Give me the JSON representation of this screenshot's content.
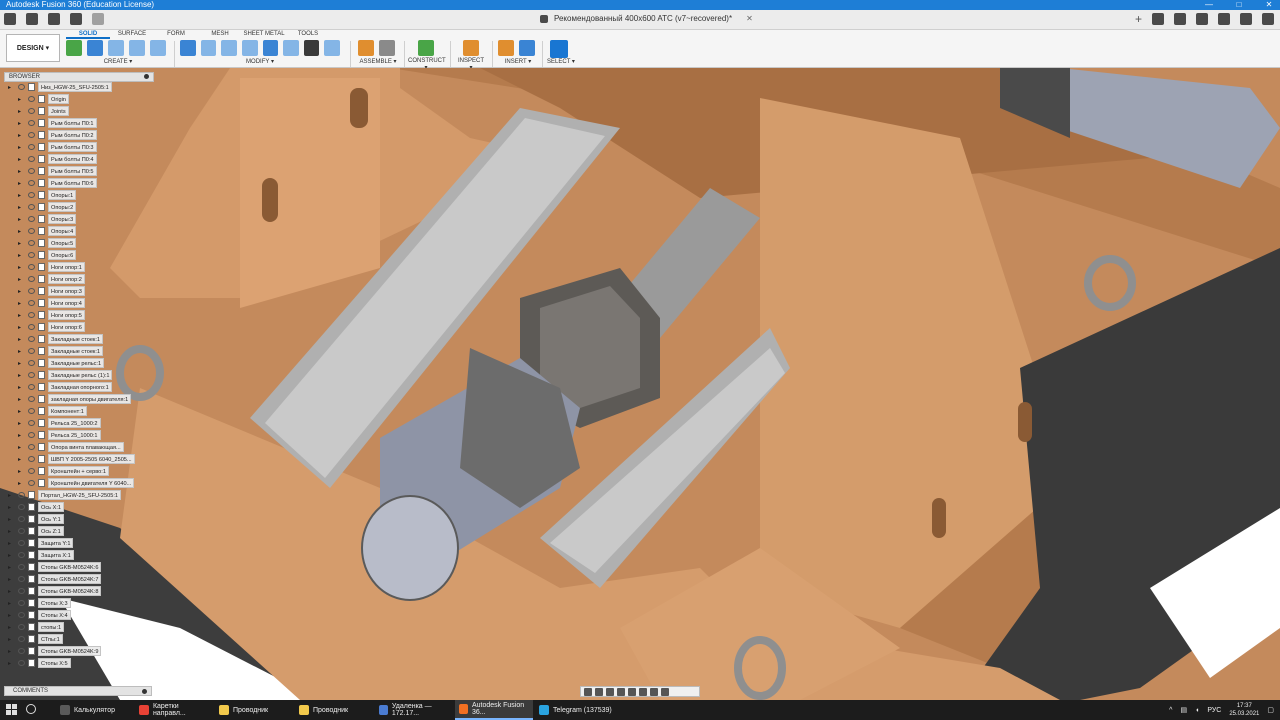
{
  "app": {
    "title": "Autodesk Fusion 360 (Education License)",
    "window_controls": [
      "—",
      "□",
      "✕"
    ]
  },
  "quick_access": {
    "document_tab": "Рекомендованный 400x600 ATC (v7~recovered)*",
    "close_symbol": "✕",
    "new_tab_symbol": "+"
  },
  "toolbar": {
    "design_label": "DESIGN ▾",
    "tabs": [
      "SOLID",
      "SURFACE",
      "FORM",
      "MESH",
      "SHEET METAL",
      "TOOLS"
    ],
    "active_tab": "SOLID",
    "groups": [
      {
        "label": "CREATE ▾"
      },
      {
        "label": "MODIFY ▾"
      },
      {
        "label": "ASSEMBLE ▾"
      },
      {
        "label": "CONSTRUCT ▾"
      },
      {
        "label": "INSPECT ▾"
      },
      {
        "label": "INSERT ▾"
      },
      {
        "label": "SELECT ▾"
      }
    ]
  },
  "browser": {
    "title": "BROWSER",
    "items": [
      {
        "label": "Низ_HGW-25_SFU-2505:1",
        "level": 0
      },
      {
        "label": "Origin",
        "level": 1
      },
      {
        "label": "Joints",
        "level": 1
      },
      {
        "label": "Рым болты П0:1",
        "level": 1
      },
      {
        "label": "Рым болты П0:2",
        "level": 1
      },
      {
        "label": "Рым болты П0:3",
        "level": 1
      },
      {
        "label": "Рым болты П0:4",
        "level": 1
      },
      {
        "label": "Рым болты П0:5",
        "level": 1
      },
      {
        "label": "Рым болты П0:6",
        "level": 1
      },
      {
        "label": "Опоры:1",
        "level": 1
      },
      {
        "label": "Опоры:2",
        "level": 1
      },
      {
        "label": "Опоры:3",
        "level": 1
      },
      {
        "label": "Опоры:4",
        "level": 1
      },
      {
        "label": "Опоры:5",
        "level": 1
      },
      {
        "label": "Опоры:6",
        "level": 1
      },
      {
        "label": "Ноги опор:1",
        "level": 1
      },
      {
        "label": "Ноги опор:2",
        "level": 1
      },
      {
        "label": "Ноги опор:3",
        "level": 1
      },
      {
        "label": "Ноги опор:4",
        "level": 1
      },
      {
        "label": "Ноги опор:5",
        "level": 1
      },
      {
        "label": "Ноги опор:6",
        "level": 1
      },
      {
        "label": "Закладные стоек:1",
        "level": 1
      },
      {
        "label": "Закладные стоек:1",
        "level": 1
      },
      {
        "label": "Закладные рельс:1",
        "level": 1
      },
      {
        "label": "Закладные рельс (1):1",
        "level": 1
      },
      {
        "label": "Закладная опорного:1",
        "level": 1
      },
      {
        "label": "закладная опоры двигателя:1",
        "level": 1
      },
      {
        "label": "Компонент:1",
        "level": 1
      },
      {
        "label": "Рельса 25_1000:2",
        "level": 1
      },
      {
        "label": "Рельса 25_1000:1",
        "level": 1
      },
      {
        "label": "Опора винта плавающая...",
        "level": 1
      },
      {
        "label": "ШВП Y 2005-2505 6040_2505...",
        "level": 1
      },
      {
        "label": "Кронштейн + серво:1",
        "level": 1
      },
      {
        "label": "Кронштейн двигателя Y 6040...",
        "level": 1
      },
      {
        "label": "Портал_HGW-25_SFU-2505:1",
        "level": 0
      },
      {
        "label": "Ось X:1",
        "level": 0
      },
      {
        "label": "Ось Y:1",
        "level": 0
      },
      {
        "label": "Ось Z:1",
        "level": 0
      },
      {
        "label": "Защита Y:1",
        "level": 0
      },
      {
        "label": "Защита X:1",
        "level": 0
      },
      {
        "label": "Стопы GKB-M0524K:6",
        "level": 0
      },
      {
        "label": "Стопы GKB-M0524K:7",
        "level": 0
      },
      {
        "label": "Стопы GKB-M0524K:8",
        "level": 0
      },
      {
        "label": "Стопы X:3",
        "level": 0
      },
      {
        "label": "Стопы X:4",
        "level": 0
      },
      {
        "label": "стопы:1",
        "level": 0
      },
      {
        "label": "СТпы:1",
        "level": 0
      },
      {
        "label": "Стопы GKB-M0524K:9",
        "level": 0
      },
      {
        "label": "Стопы X:5",
        "level": 0
      }
    ]
  },
  "comments": {
    "title": "COMMENTS"
  },
  "taskbar": {
    "tasks": [
      {
        "label": "Калькулятор",
        "color": "#5a5a5a"
      },
      {
        "label": "Каретки направл...",
        "color": "#e94235"
      },
      {
        "label": "Проводник",
        "color": "#f2c94c"
      },
      {
        "label": "Проводник",
        "color": "#f2c94c"
      },
      {
        "label": "Удаленка — 172.17...",
        "color": "#4a7bd1"
      },
      {
        "label": "Autodesk Fusion 36...",
        "color": "#f27022"
      },
      {
        "label": "Telegram (137539)",
        "color": "#2aa3df"
      }
    ],
    "active_task": 5,
    "language": "РУС",
    "time": "17:37",
    "date": "25.03.2021"
  }
}
